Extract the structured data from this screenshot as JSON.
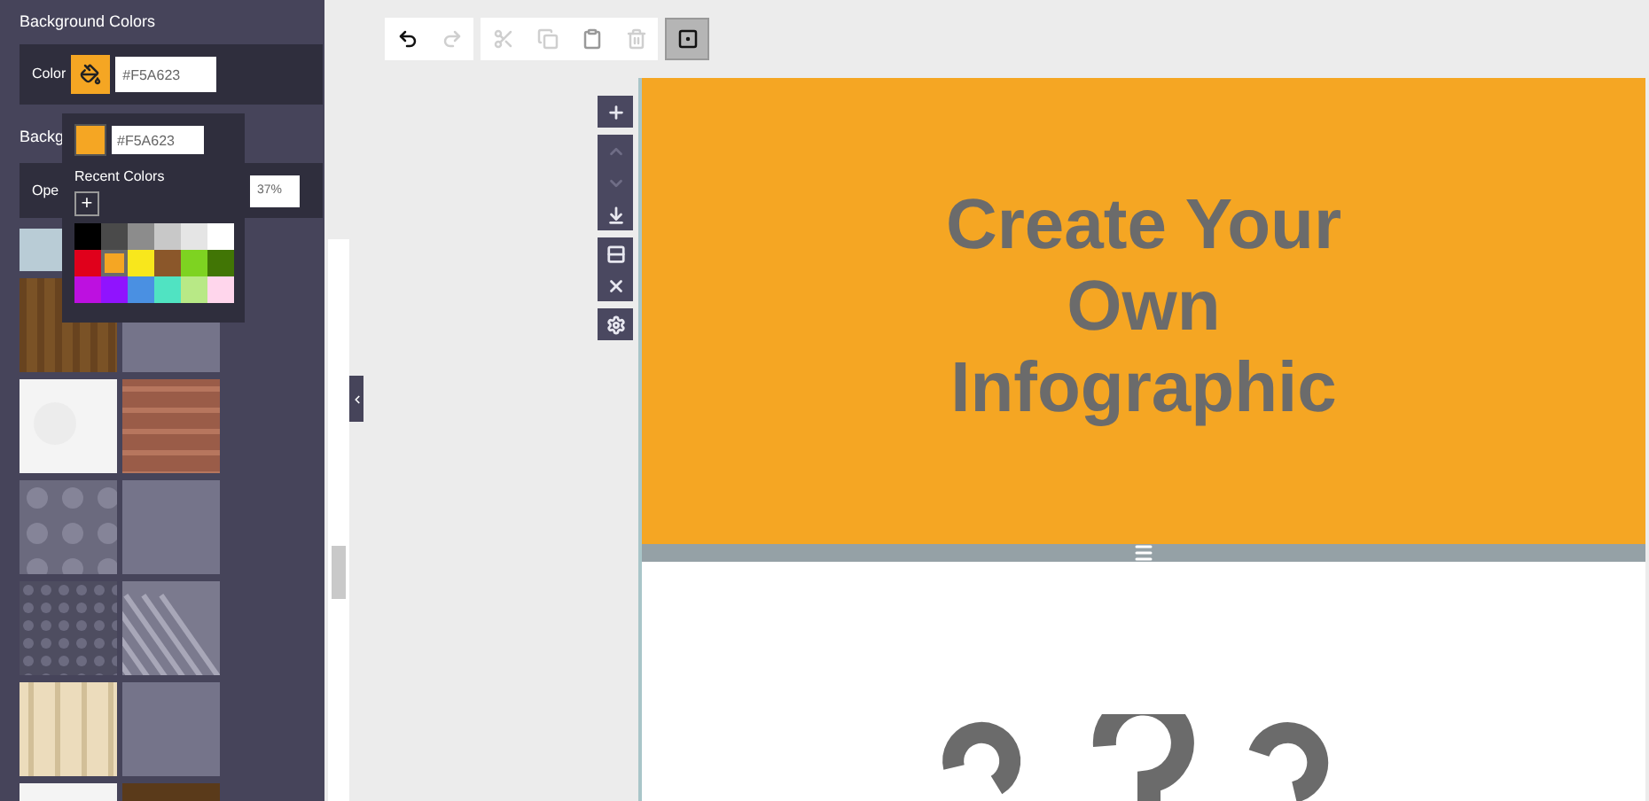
{
  "sidebar": {
    "section_title": "Background Colors",
    "color_label": "Color",
    "color_value": "#F5A623",
    "second_title": "Backg",
    "opacity_label": "Ope",
    "opacity_value": "37%",
    "textures": [
      [
        {
          "kind": "ice"
        }
      ],
      [
        {
          "kind": "wood"
        },
        {
          "kind": "slate"
        }
      ],
      [
        {
          "kind": "paper"
        },
        {
          "kind": "brick"
        }
      ],
      [
        {
          "kind": "stars"
        },
        {
          "kind": "slate"
        }
      ],
      [
        {
          "kind": "mesh"
        },
        {
          "kind": "weave"
        }
      ],
      [
        {
          "kind": "birch"
        },
        {
          "kind": "slate"
        }
      ],
      [
        {
          "kind": "paper"
        },
        {
          "kind": "dark-wood"
        }
      ]
    ]
  },
  "color_popover": {
    "hex": "#F5A623",
    "recent_label": "Recent Colors",
    "add_label": "+",
    "colors": [
      {
        "color": "#000000",
        "selected": false
      },
      {
        "color": "#4a4a4a",
        "selected": false
      },
      {
        "color": "#8c8c8c",
        "selected": false
      },
      {
        "color": "#c8c8c8",
        "selected": false
      },
      {
        "color": "#e5e5e5",
        "selected": false
      },
      {
        "color": "#ffffff",
        "selected": false
      },
      {
        "color": "#e0001b",
        "selected": false
      },
      {
        "color": "#f5a623",
        "selected": true
      },
      {
        "color": "#f8e71c",
        "selected": false
      },
      {
        "color": "#8b572a",
        "selected": false
      },
      {
        "color": "#7ed321",
        "selected": false
      },
      {
        "color": "#417505",
        "selected": false
      },
      {
        "color": "#bd10e0",
        "selected": false
      },
      {
        "color": "#9013fe",
        "selected": false
      },
      {
        "color": "#4a90e2",
        "selected": false
      },
      {
        "color": "#50e3c2",
        "selected": false
      },
      {
        "color": "#b8e986",
        "selected": false
      },
      {
        "color": "#ffd6ec",
        "selected": false
      }
    ]
  },
  "toolbar": [
    {
      "kind": "undo",
      "disabled": false,
      "selected": false
    },
    {
      "kind": "redo",
      "disabled": true,
      "selected": false
    },
    {
      "kind": "cut",
      "disabled": true,
      "selected": false
    },
    {
      "kind": "copy",
      "disabled": true,
      "selected": false
    },
    {
      "kind": "paste",
      "disabled": false,
      "selected": false
    },
    {
      "kind": "delete",
      "disabled": true,
      "selected": false
    },
    {
      "kind": "select",
      "disabled": false,
      "selected": true
    }
  ],
  "block_tools": [
    {
      "kind": "add",
      "disabled": false
    },
    {
      "kind": "move-up",
      "disabled": true
    },
    {
      "kind": "move-down",
      "disabled": true
    },
    {
      "kind": "move-bottom",
      "disabled": false
    },
    {
      "kind": "rows",
      "disabled": false
    },
    {
      "kind": "remove",
      "disabled": false
    },
    {
      "kind": "settings",
      "disabled": false
    }
  ],
  "hero": {
    "title_lines": [
      "Create Your",
      "Own",
      "Infographic"
    ]
  }
}
